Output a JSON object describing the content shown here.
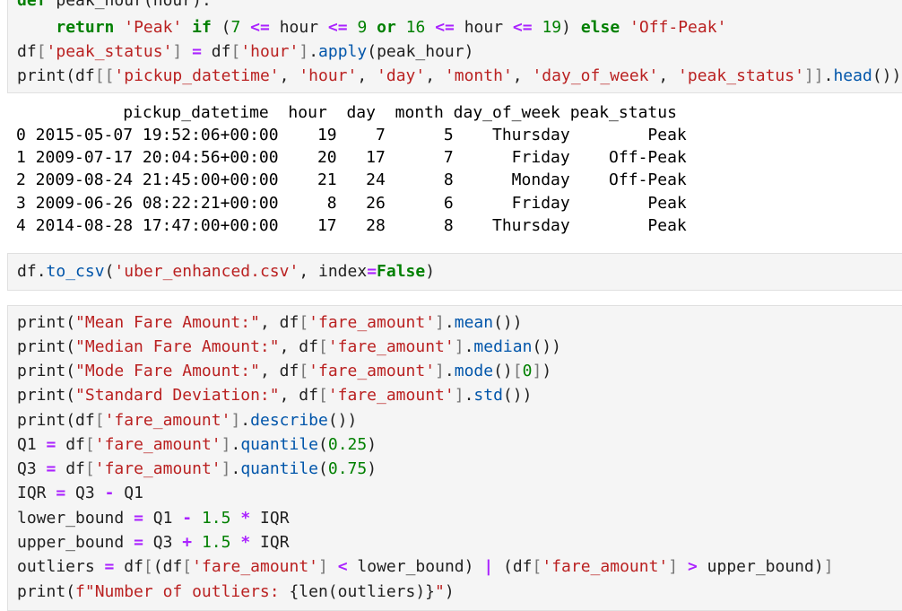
{
  "cell1": {
    "lines": [
      "def peak_hour(hour):",
      "    return 'Peak' if (7 <= hour <= 9 or 16 <= hour <= 19) else 'Off-Peak'",
      "df['peak_status'] = df['hour'].apply(peak_hour)",
      "print(df[['pickup_datetime', 'hour', 'day', 'month', 'day_of_week', 'peak_status']].head())"
    ]
  },
  "output1": {
    "header": "           pickup_datetime  hour  day  month day_of_week peak_status",
    "rows": [
      "0 2015-05-07 19:52:06+00:00    19    7      5    Thursday        Peak",
      "1 2009-07-17 20:04:56+00:00    20   17      7      Friday    Off-Peak",
      "2 2009-08-24 21:45:00+00:00    21   24      8      Monday    Off-Peak",
      "3 2009-06-26 08:22:21+00:00     8   26      6      Friday        Peak",
      "4 2014-08-28 17:47:00+00:00    17   28      8    Thursday        Peak"
    ]
  },
  "cell2": {
    "lines": [
      "df.to_csv('uber_enhanced.csv', index=False)"
    ]
  },
  "cell3": {
    "lines": [
      "print(\"Mean Fare Amount:\", df['fare_amount'].mean())",
      "print(\"Median Fare Amount:\", df['fare_amount'].median())",
      "print(\"Mode Fare Amount:\", df['fare_amount'].mode()[0])",
      "print(\"Standard Deviation:\", df['fare_amount'].std())",
      "print(df['fare_amount'].describe())",
      "Q1 = df['fare_amount'].quantile(0.25)",
      "Q3 = df['fare_amount'].quantile(0.75)",
      "IQR = Q3 - Q1",
      "lower_bound = Q1 - 1.5 * IQR",
      "upper_bound = Q3 + 1.5 * IQR",
      "outliers = df[(df['fare_amount'] < lower_bound) | (df['fare_amount'] > upper_bound)]",
      "print(f\"Number of outliers: {len(outliers)}\")"
    ]
  }
}
